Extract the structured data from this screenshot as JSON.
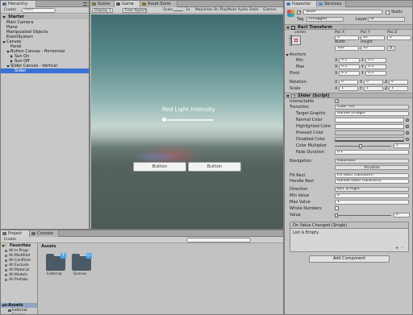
{
  "hierarchy": {
    "tab": "Hierarchy",
    "create": "Create",
    "search_placeholder": "Q▾All",
    "scene": "Starter",
    "items": [
      {
        "label": "Main Camera",
        "depth": 1
      },
      {
        "label": "Plane",
        "depth": 1
      },
      {
        "label": "Manipulated Objects",
        "depth": 1
      },
      {
        "label": "EventSystem",
        "depth": 1
      },
      {
        "label": "Canvas",
        "depth": 1
      },
      {
        "label": "Panel",
        "depth": 2
      },
      {
        "label": "Button Canvas - Horizontal",
        "depth": 2
      },
      {
        "label": "Sun On",
        "depth": 3
      },
      {
        "label": "Sun Off",
        "depth": 3
      },
      {
        "label": "Slider Canvas - Vertical",
        "depth": 2
      },
      {
        "label": "Slider",
        "depth": 3,
        "selected": true
      }
    ]
  },
  "scene_tab": "Scene",
  "game_tab": "Game",
  "asset_store_tab": "Asset Store",
  "game": {
    "display": "Display 1",
    "aspect": "Free Aspect",
    "scale_label": "Scale",
    "scale_value": "1x",
    "maximize": "Maximize On Play",
    "mute": "Mute Audio",
    "stats": "Stats",
    "gizmos": "Gizmos",
    "slider_label": "Red Light Intensity",
    "button1": "Button",
    "button2": "Button"
  },
  "inspector": {
    "tab": "Inspector",
    "services_tab": "Services",
    "object_name": "Slider",
    "static_label": "Static",
    "tag_label": "Tag",
    "tag_value": "Untagged",
    "layer_label": "Layer",
    "layer_value": "UI",
    "rect_transform": {
      "title": "Rect Transform",
      "anchor_preset": "center",
      "middle": "middle",
      "pos_x_label": "Pos X",
      "pos_y_label": "Pos Y",
      "pos_z_label": "Pos Z",
      "pos_x": "0",
      "pos_y": "20",
      "pos_z": "0",
      "width_label": "Width",
      "height_label": "Height",
      "width": "160",
      "height": "20",
      "anchors_label": "Anchors",
      "min_label": "Min",
      "min_x": "0.5",
      "min_y": "0.5",
      "max_label": "Max",
      "max_x": "0.5",
      "max_y": "0.5",
      "pivot_label": "Pivot",
      "pivot_x": "0.5",
      "pivot_y": "0.5",
      "rotation_label": "Rotation",
      "rot_x": "0",
      "rot_y": "0",
      "rot_z": "0",
      "scale_label": "Scale",
      "scale_x": "1",
      "scale_y": "1",
      "scale_z": "1",
      "x": "X",
      "y": "Y",
      "z": "Z",
      "r": "R"
    },
    "slider": {
      "title": "Slider (Script)",
      "interactable_label": "Interactable",
      "transition_label": "Transition",
      "transition_value": "Color Tint",
      "target_graphic_label": "Target Graphic",
      "target_graphic_value": "Handle (Image)",
      "normal_color_label": "Normal Color",
      "highlighted_color_label": "Highlighted Color",
      "pressed_color_label": "Pressed Color",
      "disabled_color_label": "Disabled Color",
      "color_multiplier_label": "Color Multiplier",
      "color_multiplier_value": "1",
      "fade_duration_label": "Fade Duration",
      "fade_duration_value": "0.1",
      "navigation_label": "Navigation",
      "navigation_value": "Automatic",
      "visualize": "Visualize",
      "fill_rect_label": "Fill Rect",
      "fill_rect_value": "Fill (Rect Transform)",
      "handle_rect_label": "Handle Rect",
      "handle_rect_value": "Handle (Rect Transform)",
      "direction_label": "Direction",
      "direction_value": "Left To Right",
      "min_value_label": "Min Value",
      "min_value": "0",
      "max_value_label": "Max Value",
      "max_value": "1",
      "whole_numbers_label": "Whole Numbers",
      "value_label": "Value",
      "value": "0",
      "event_title": "On Value Changed (Single)",
      "event_empty": "List is Empty",
      "plus": "+",
      "minus": "-"
    },
    "add_component": "Add Component"
  },
  "project": {
    "tab": "Project",
    "console_tab": "Console",
    "create": "Create",
    "favorites": "Favorites",
    "favorites_items": [
      "All In Progr",
      "All Modified",
      "All Conflicte",
      "All Exclude",
      "All Material",
      "All Models",
      "All Prefabs"
    ],
    "assets_root": "Assets",
    "assets_children": [
      "External",
      "Scenes"
    ],
    "breadcrumb": "Assets",
    "folders": [
      "External",
      "Scenes"
    ]
  }
}
